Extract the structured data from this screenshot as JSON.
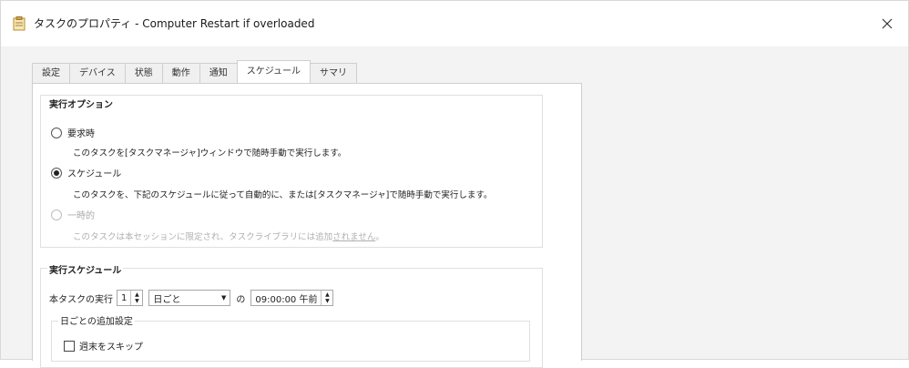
{
  "window": {
    "title": "タスクのプロパティ - Computer Restart if overloaded"
  },
  "tabs": [
    {
      "label": "設定"
    },
    {
      "label": "デバイス"
    },
    {
      "label": "状態"
    },
    {
      "label": "動作"
    },
    {
      "label": "通知"
    },
    {
      "label": "スケジュール"
    },
    {
      "label": "サマリ"
    }
  ],
  "active_tab": "スケジュール",
  "run_options": {
    "title": "実行オプション",
    "on_demand": {
      "label": "要求時",
      "description": "このタスクを[タスクマネージャ]ウィンドウで随時手動で実行します。"
    },
    "scheduled": {
      "label": "スケジュール",
      "description": "このタスクを、下記のスケジュールに従って自動的に、または[タスクマネージャ]で随時手動で実行します。"
    },
    "one_time": {
      "label": "一時的",
      "description_prefix": "このタスクは本セッションに限定され、タスクライブラリには追加",
      "description_link": "されません",
      "description_suffix": "。"
    }
  },
  "schedule": {
    "title": "実行スケジュール",
    "run_label": "本タスクの実行",
    "count_value": "1",
    "frequency_value": "日ごと",
    "at_label": "の",
    "time_value": "09:00:00 午前",
    "daily_group_title": "日ごとの追加設定",
    "skip_weekends_label": "週末をスキップ"
  },
  "colors": {
    "active_tab_bg": "#ffffff",
    "dialog_bg": "#f3f3f3"
  },
  "icons": {
    "title": "task-properties-icon",
    "close": "close-icon"
  }
}
